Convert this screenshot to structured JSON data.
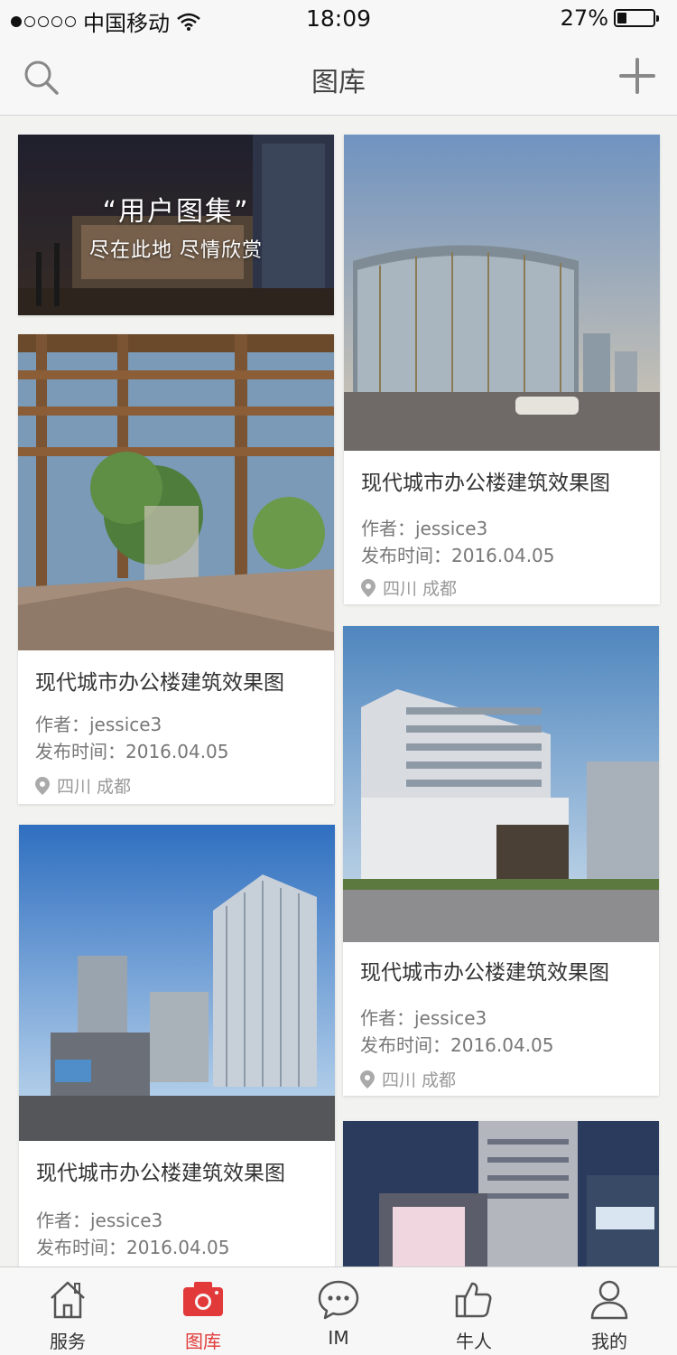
{
  "status_bar": {
    "carrier": "中国移动",
    "time": "18:09",
    "battery": "27%",
    "battery_level": 0.27
  },
  "nav": {
    "title": "图库",
    "search_icon": "search-icon",
    "add_icon": "plus-icon"
  },
  "banner": {
    "title": "“用户图集”",
    "subtitle": "尽在此地 尽情欣赏"
  },
  "cards": [
    {
      "title": "现代城市办公楼建筑效果图",
      "author": "作者：jessice3",
      "date": "发布时间：2016.04.05",
      "location": "四川 成都"
    },
    {
      "title": "现代城市办公楼建筑效果图",
      "author": "作者：jessice3",
      "date": "发布时间：2016.04.05",
      "location": "四川 成都"
    },
    {
      "title": "现代城市办公楼建筑效果图",
      "author": "作者：jessice3",
      "date": "发布时间：2016.04.05",
      "location": "四川 成都"
    },
    {
      "title": "现代城市办公楼建筑效果图",
      "author": "作者：jessice3",
      "date": "发布时间：2016.04.05",
      "location": ""
    }
  ],
  "tab_bar": {
    "items": [
      {
        "label": "服务",
        "icon": "home-icon"
      },
      {
        "label": "图库",
        "icon": "camera-icon"
      },
      {
        "label": "IM",
        "icon": "chat-icon"
      },
      {
        "label": "牛人",
        "icon": "thumbs-up-icon"
      },
      {
        "label": "我的",
        "icon": "user-icon"
      }
    ],
    "active_index": 1,
    "active_color": "#e23a3a"
  }
}
